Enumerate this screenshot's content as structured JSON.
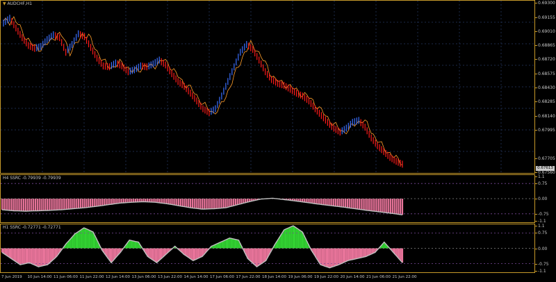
{
  "colors": {
    "frame": "#c79a2a",
    "grid": "#1c2a4a",
    "up": "#3a6fff",
    "down": "#ff1a1a",
    "signal": "#ff9d2a",
    "pink": "#e8749a",
    "green": "#32d232",
    "curve": "#c0c0c0",
    "zero": "#c79a2a"
  },
  "chart": {
    "symbol_label": "AUDCHF,H1",
    "collapse_icon": "triangle-down-icon",
    "price_current": "0.67613",
    "price_ticks": [
      "0.69300",
      "0.69155",
      "0.69010",
      "0.68865",
      "0.68720",
      "0.68575",
      "0.68430",
      "0.68285",
      "0.68140",
      "0.67995",
      "0.67705",
      "0.67560"
    ]
  },
  "ssrc_h4": {
    "label": "H4 SSRC -0.79939 -0.79939",
    "ticks": [
      "1.1",
      "0.75",
      "0.00",
      "-0.75",
      "-1.1"
    ]
  },
  "ssrc_h1": {
    "label": "H1 SSRC -0.72771 -0.72771",
    "ticks": [
      "1.1",
      "0.75",
      "0.00",
      "-0.75",
      "-1.1"
    ]
  },
  "time_axis": [
    "7 Jun 2019",
    "10 Jun 14:00",
    "11 Jun 06:00",
    "11 Jun 22:00",
    "12 Jun 14:00",
    "13 Jun 06:00",
    "13 Jun 22:00",
    "14 Jun 14:00",
    "17 Jun 06:00",
    "17 Jun 22:00",
    "18 Jun 14:00",
    "19 Jun 06:00",
    "19 Jun 22:00",
    "20 Jun 14:00",
    "21 Jun 06:00",
    "21 Jun 22:00"
  ],
  "chart_data": [
    {
      "type": "line",
      "title": "AUDCHF,H1",
      "ylim": [
        0.6756,
        0.6933
      ],
      "x_index": [
        0,
        3,
        6,
        9,
        12,
        15,
        18,
        21,
        24,
        27,
        30,
        33,
        36,
        39,
        42,
        45,
        48,
        51,
        54,
        57,
        60,
        63,
        66,
        69,
        72,
        75,
        78,
        81,
        84,
        87,
        90,
        93,
        96,
        99,
        102,
        105,
        108,
        111,
        114,
        117,
        120,
        123,
        126,
        129,
        132,
        135,
        138,
        141,
        144,
        147,
        150,
        153,
        156,
        159,
        162,
        165,
        168,
        171,
        174,
        177,
        180,
        183,
        186,
        189,
        192
      ],
      "series": [
        {
          "values": [
            0.691,
            0.6915,
            0.6905,
            0.6895,
            0.6887,
            0.6884,
            0.6886,
            0.6893,
            0.6898,
            0.6895,
            0.688,
            0.6888,
            0.6899,
            0.6896,
            0.6885,
            0.6874,
            0.6866,
            0.6865,
            0.6869,
            0.6866,
            0.686,
            0.6862,
            0.6866,
            0.6865,
            0.6868,
            0.6872,
            0.6867,
            0.6858,
            0.685,
            0.6845,
            0.6838,
            0.683,
            0.6822,
            0.6818,
            0.6822,
            0.6835,
            0.685,
            0.6865,
            0.688,
            0.6888,
            0.6883,
            0.6872,
            0.686,
            0.6852,
            0.6848,
            0.6846,
            0.6842,
            0.6838,
            0.6835,
            0.683,
            0.6822,
            0.6815,
            0.6808,
            0.6802,
            0.6798,
            0.6802,
            0.6808,
            0.681,
            0.6803,
            0.6792,
            0.6784,
            0.6778,
            0.6772,
            0.6768,
            0.6765
          ]
        }
      ]
    },
    {
      "type": "area",
      "title": "H4 SSRC -0.79939 -0.79939",
      "ylim": [
        -1.1,
        1.1
      ],
      "series": [
        {
          "values": [
            -0.55,
            -0.6,
            -0.62,
            -0.6,
            -0.58,
            -0.55,
            -0.5,
            -0.45,
            -0.38,
            -0.3,
            -0.22,
            -0.18,
            -0.15,
            -0.18,
            -0.25,
            -0.35,
            -0.45,
            -0.52,
            -0.5,
            -0.45,
            -0.3,
            -0.15,
            -0.02,
            0.02,
            -0.05,
            -0.12,
            -0.2,
            -0.28,
            -0.35,
            -0.42,
            -0.5,
            -0.58,
            -0.65,
            -0.72,
            -0.8
          ]
        }
      ]
    },
    {
      "type": "area",
      "title": "H1 SSRC -0.72771 -0.72771",
      "ylim": [
        -1.1,
        1.1
      ],
      "series": [
        {
          "values": [
            -0.2,
            -0.5,
            -0.8,
            -0.7,
            -0.9,
            -0.8,
            -0.4,
            0.2,
            0.7,
            1.0,
            0.8,
            -0.1,
            -0.7,
            -0.2,
            0.4,
            0.3,
            -0.4,
            -0.7,
            -0.3,
            0.1,
            -0.3,
            -0.6,
            -0.4,
            0.1,
            0.3,
            0.5,
            0.4,
            -0.5,
            -0.9,
            -0.6,
            0.2,
            0.9,
            1.1,
            0.8,
            -0.1,
            -0.8,
            -0.95,
            -0.8,
            -0.6,
            -0.5,
            -0.4,
            -0.2,
            0.3,
            -0.2,
            -0.7
          ]
        }
      ]
    }
  ]
}
